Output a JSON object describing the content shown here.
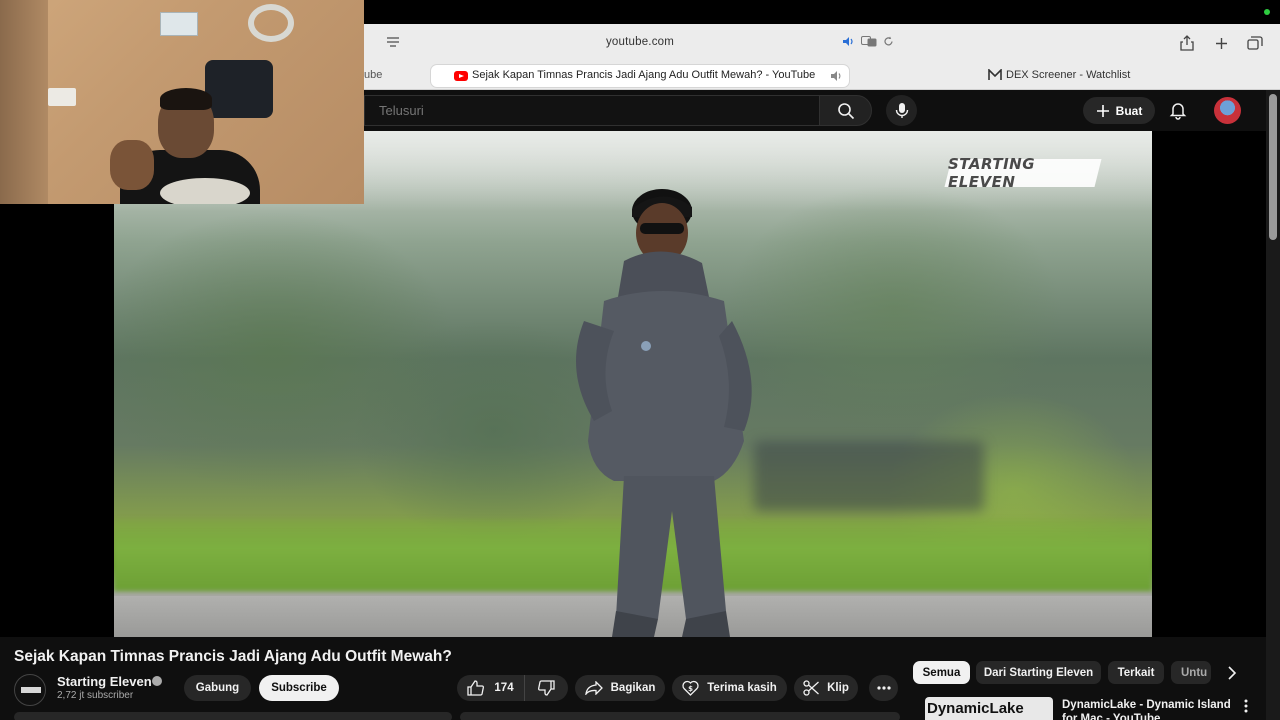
{
  "browser": {
    "url": "youtube.com",
    "tabs": [
      {
        "label": "ube",
        "active": false
      },
      {
        "label": "Sejak Kapan Timnas Prancis Jadi Ajang Adu Outfit Mewah? - YouTube",
        "active": true,
        "icon": "youtube-icon",
        "audio": true
      },
      {
        "label": "DEX Screener - Watchlist",
        "active": false,
        "icon": "dex-icon"
      }
    ]
  },
  "header": {
    "search_placeholder": "Telusuri",
    "create_label": "Buat"
  },
  "video": {
    "watermark": "STARTING ELEVEN",
    "title": "Sejak Kapan Timnas Prancis Jadi Ajang Adu Outfit Mewah?"
  },
  "channel": {
    "name": "Starting Eleven",
    "subscribers": "2,72 jt subscriber",
    "join_label": "Gabung",
    "subscribe_label": "Subscribe"
  },
  "actions": {
    "like_count": "174",
    "share_label": "Bagikan",
    "thanks_label": "Terima kasih",
    "clip_label": "Klip"
  },
  "chips": [
    "Semua",
    "Dari Starting Eleven",
    "Terkait",
    "Untu"
  ],
  "recommendation": {
    "thumb_text": "DynamicLake",
    "title": "DynamicLake - Dynamic Island for Mac - YouTube"
  },
  "colors": {
    "youtube_red": "#ff0000",
    "dark_bg": "#0f0f0f",
    "pill_bg": "#272727"
  }
}
